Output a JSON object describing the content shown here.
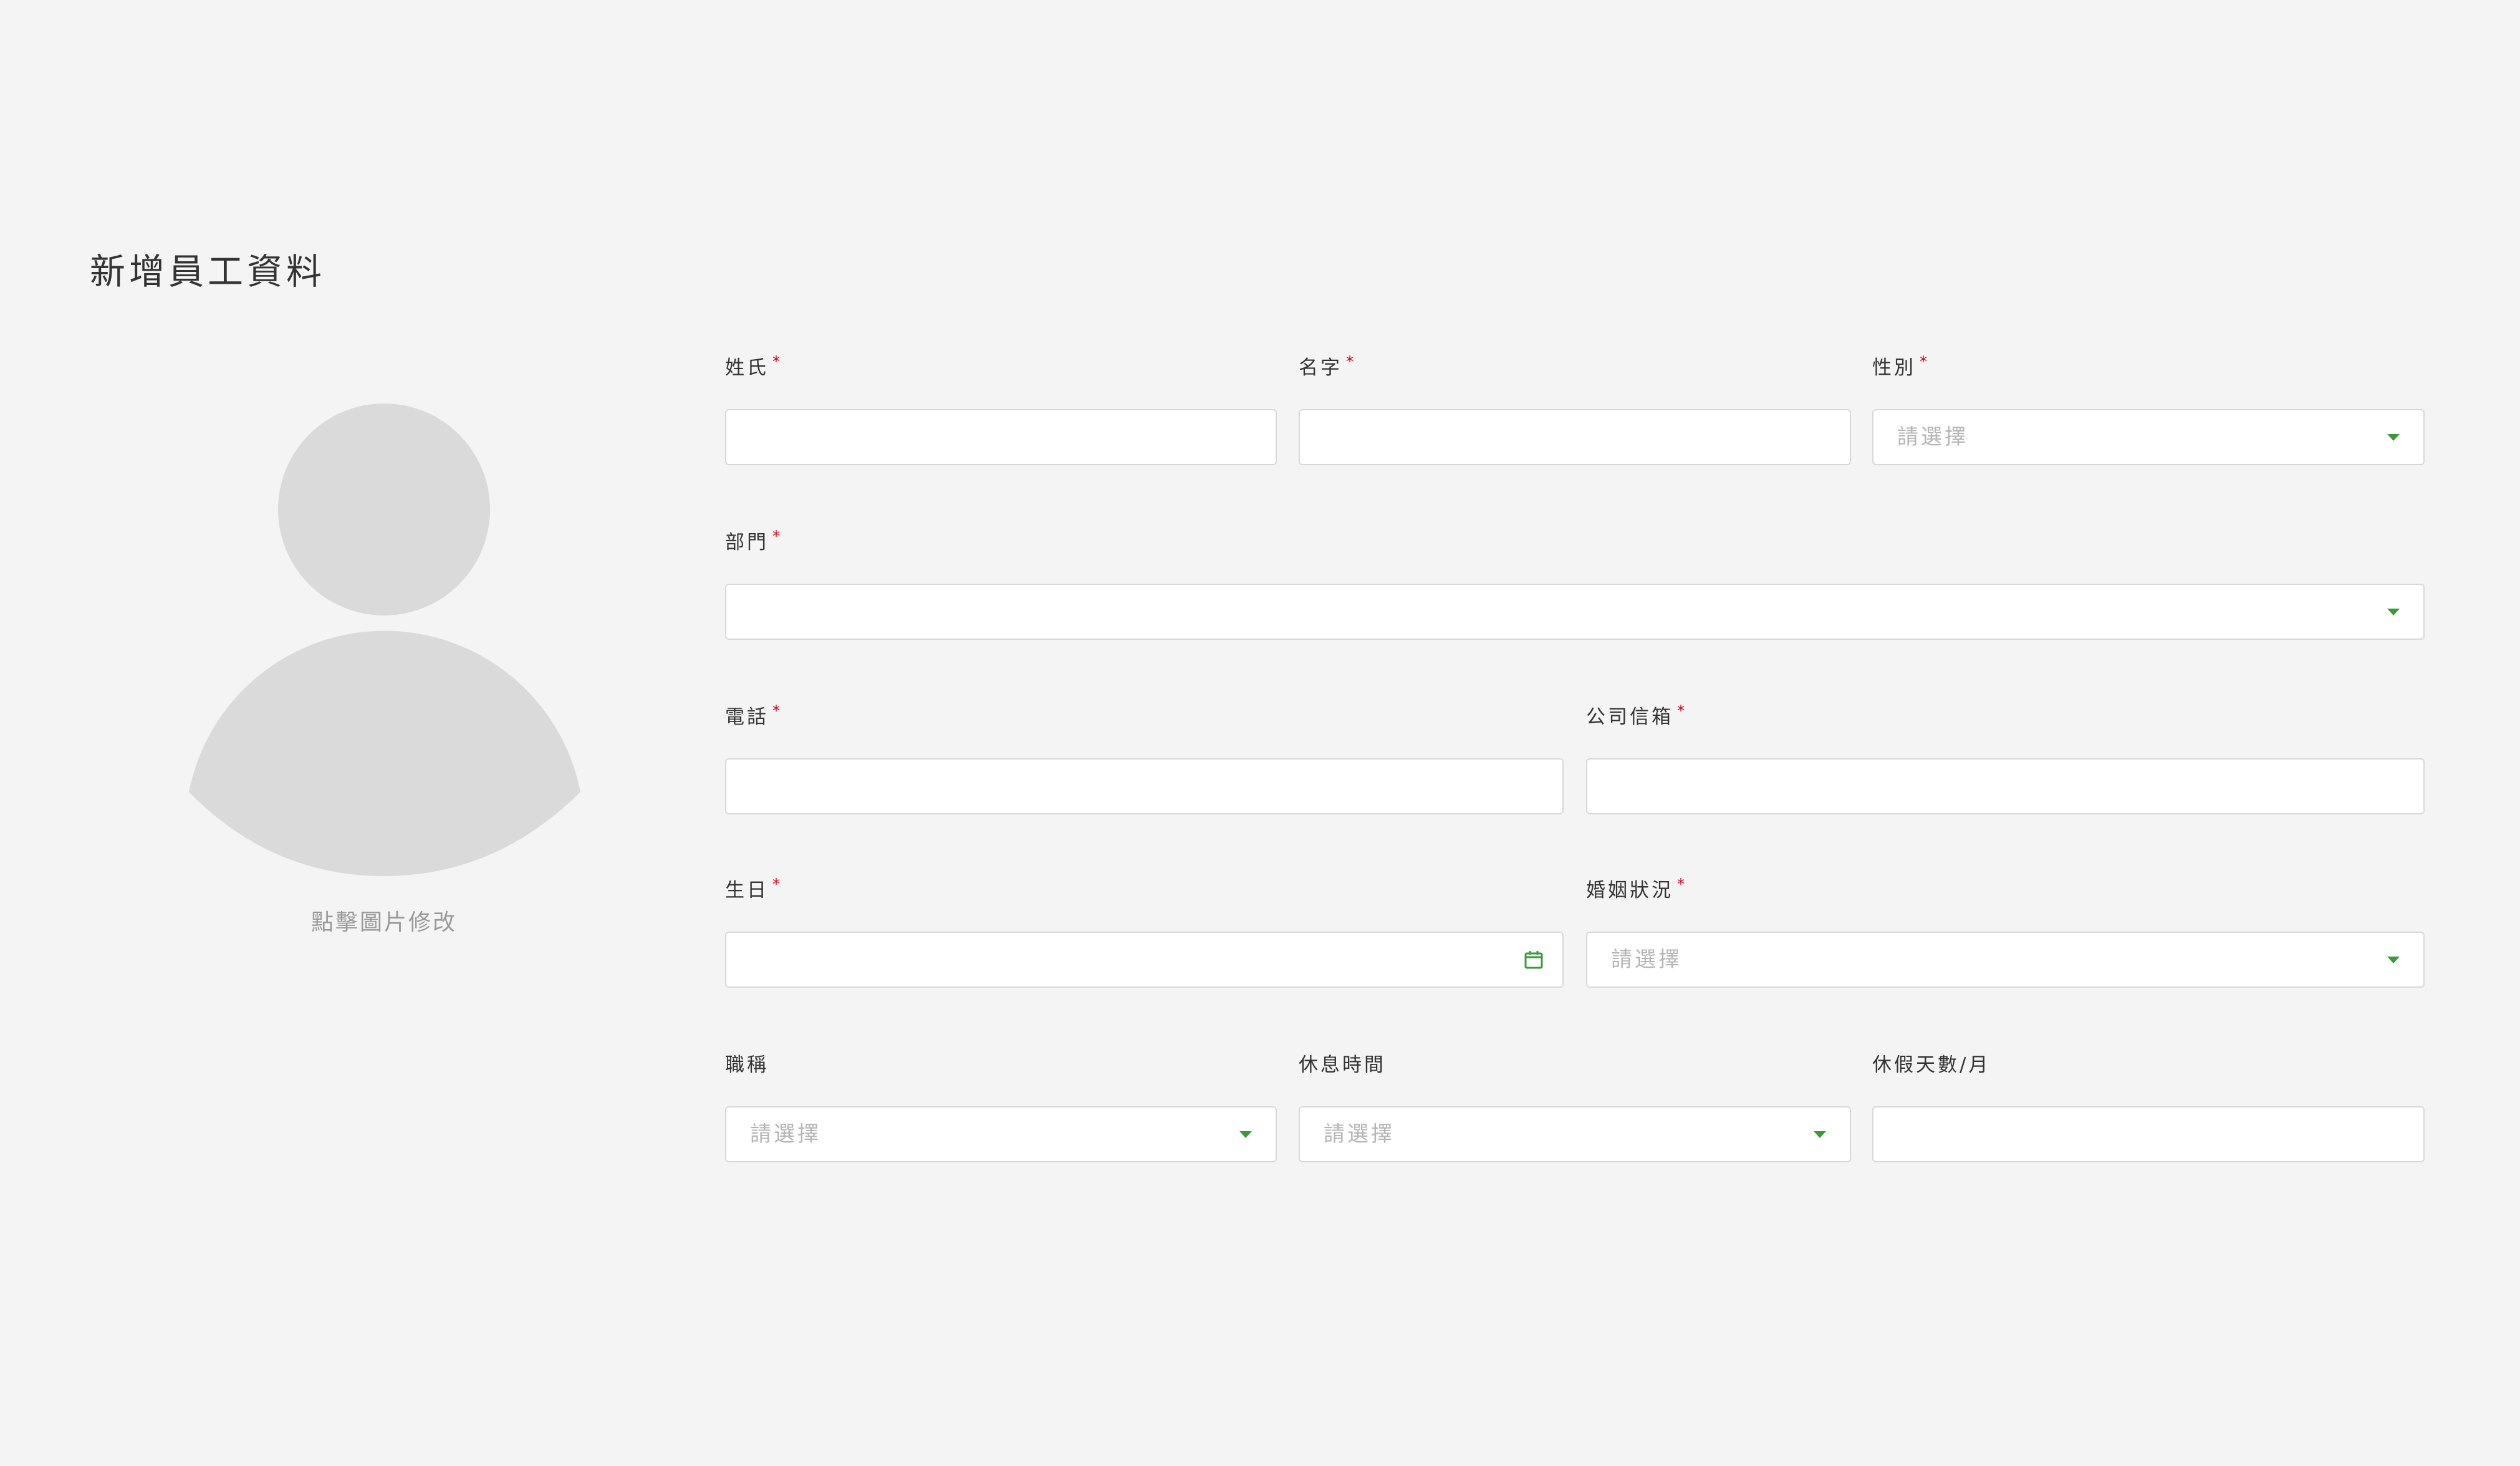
{
  "page": {
    "title": "新增員工資料"
  },
  "avatar": {
    "caption": "點擊圖片修改"
  },
  "form": {
    "last_name": {
      "label": "姓氏",
      "value": "",
      "required": true
    },
    "first_name": {
      "label": "名字",
      "value": "",
      "required": true
    },
    "gender": {
      "label": "性別",
      "placeholder": "請選擇",
      "required": true
    },
    "department": {
      "label": "部門",
      "placeholder": "",
      "required": true
    },
    "phone": {
      "label": "電話",
      "value": "",
      "required": true
    },
    "company_email": {
      "label": "公司信箱",
      "value": "",
      "required": true
    },
    "birthday": {
      "label": "生日",
      "value": "",
      "required": true
    },
    "marital_status": {
      "label": "婚姻狀況",
      "placeholder": "請選擇",
      "required": true
    },
    "job_title": {
      "label": "職稱",
      "placeholder": "請選擇",
      "required": false
    },
    "rest_time": {
      "label": "休息時間",
      "placeholder": "請選擇",
      "required": false
    },
    "leave_days_per_month": {
      "label": "休假天數/月",
      "value": "",
      "required": false
    }
  },
  "icons": {
    "dropdown": "chevron-down-icon",
    "calendar": "calendar-icon",
    "required_marker": "*"
  },
  "colors": {
    "background": "#f4f4f4",
    "accent": "#3a9a3a",
    "required": "#d0021b",
    "avatar": "#dadada",
    "placeholder": "#b5b5b5"
  }
}
